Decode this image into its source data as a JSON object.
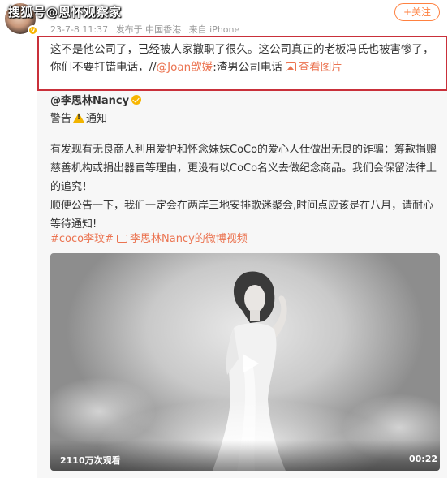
{
  "watermark": "搜狐号@恩怀观察家",
  "post": {
    "meta": {
      "date": "23-7-8 11:37",
      "source": "发布于 中国香港",
      "device": "来自 iPhone"
    },
    "follow_label": "+关注",
    "text": "这不是他公司了，已经被人家撤职了很久。这公司真正的老板冯氏也被害惨了，你们不要打错电话，//",
    "mention": "@Joan歆媛",
    "mention_suffix": ":渣男公司电话",
    "view_image_label": "查看图片"
  },
  "repost": {
    "author": "@李思林Nancy",
    "warning_prefix": "警告",
    "warning_suffix": "通知",
    "body_p1": "有发现有无良商人利用爱护和怀念妹妹CoCo的爱心人仕做出无良的诈骗：筹款捐赠慈善机构或捐出器官等理由，更没有以CoCo名义去做纪念商品。我们会保留法律上的追究！",
    "body_p2": "顺便公告一下，我们一定会在两岸三地安排歌迷聚会,时间点应该是在八月，请耐心等待通知!",
    "topic": "#coco李玟#",
    "video_link": "李思林Nancy的微博视频",
    "video": {
      "views": "2110万次观看",
      "duration": "00:22"
    }
  },
  "colors": {
    "accent": "#eb7350",
    "follow": "#ff8140",
    "highlight_border": "#c9303a",
    "repost_bg": "#f7f7f7"
  }
}
